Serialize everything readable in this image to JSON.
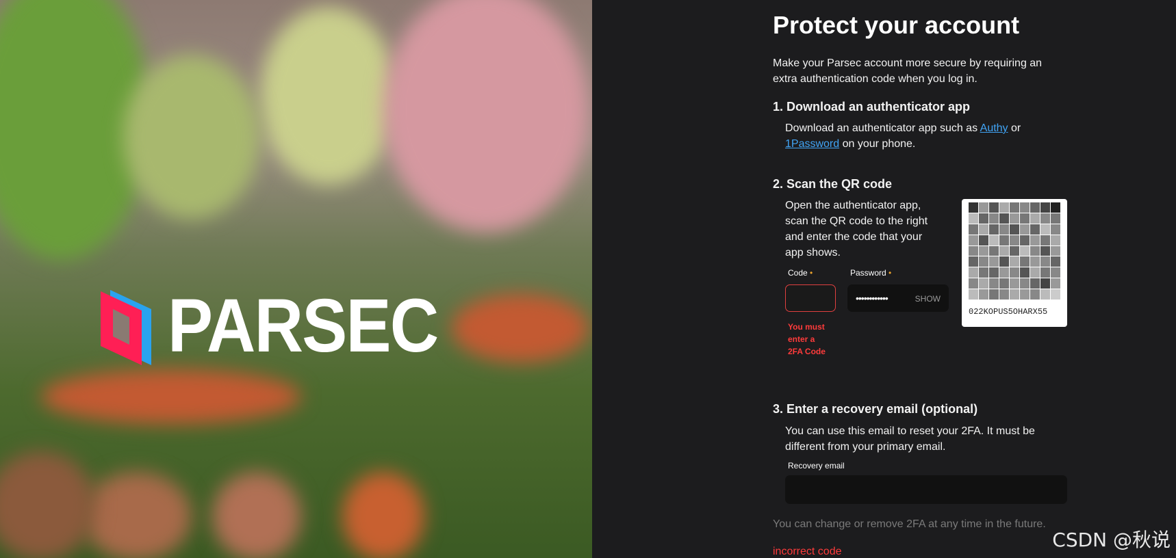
{
  "brand": {
    "name": "PARSEC"
  },
  "title": "Protect your account",
  "intro": "Make your Parsec account more secure by requiring an extra authentication code when you log in.",
  "steps": [
    {
      "heading": "1. Download an authenticator app",
      "text_before": "Download an authenticator app such as ",
      "link1": "Authy",
      "text_mid": " or ",
      "link2": "1Password",
      "text_after": " on your phone."
    },
    {
      "heading": "2. Scan the QR code",
      "text": "Open the authenticator app, scan the QR code to the right and enter the code that your app shows."
    },
    {
      "heading": "3. Enter a recovery email (optional)",
      "text": "You can use this email to reset your 2FA. It must be different from your primary email."
    }
  ],
  "form": {
    "code_label": "Code",
    "password_label": "Password",
    "required_mark": "•",
    "password_value": "••••••••••••",
    "show_button": "SHOW",
    "code_error": "You must enter a 2FA Code",
    "recovery_label": "Recovery email"
  },
  "qr": {
    "secret": "022KOPUS5OHARX55"
  },
  "footnote": "You can change or remove 2FA at any time in the future.",
  "error_message": "incorrect code",
  "watermark": "CSDN @秋说"
}
